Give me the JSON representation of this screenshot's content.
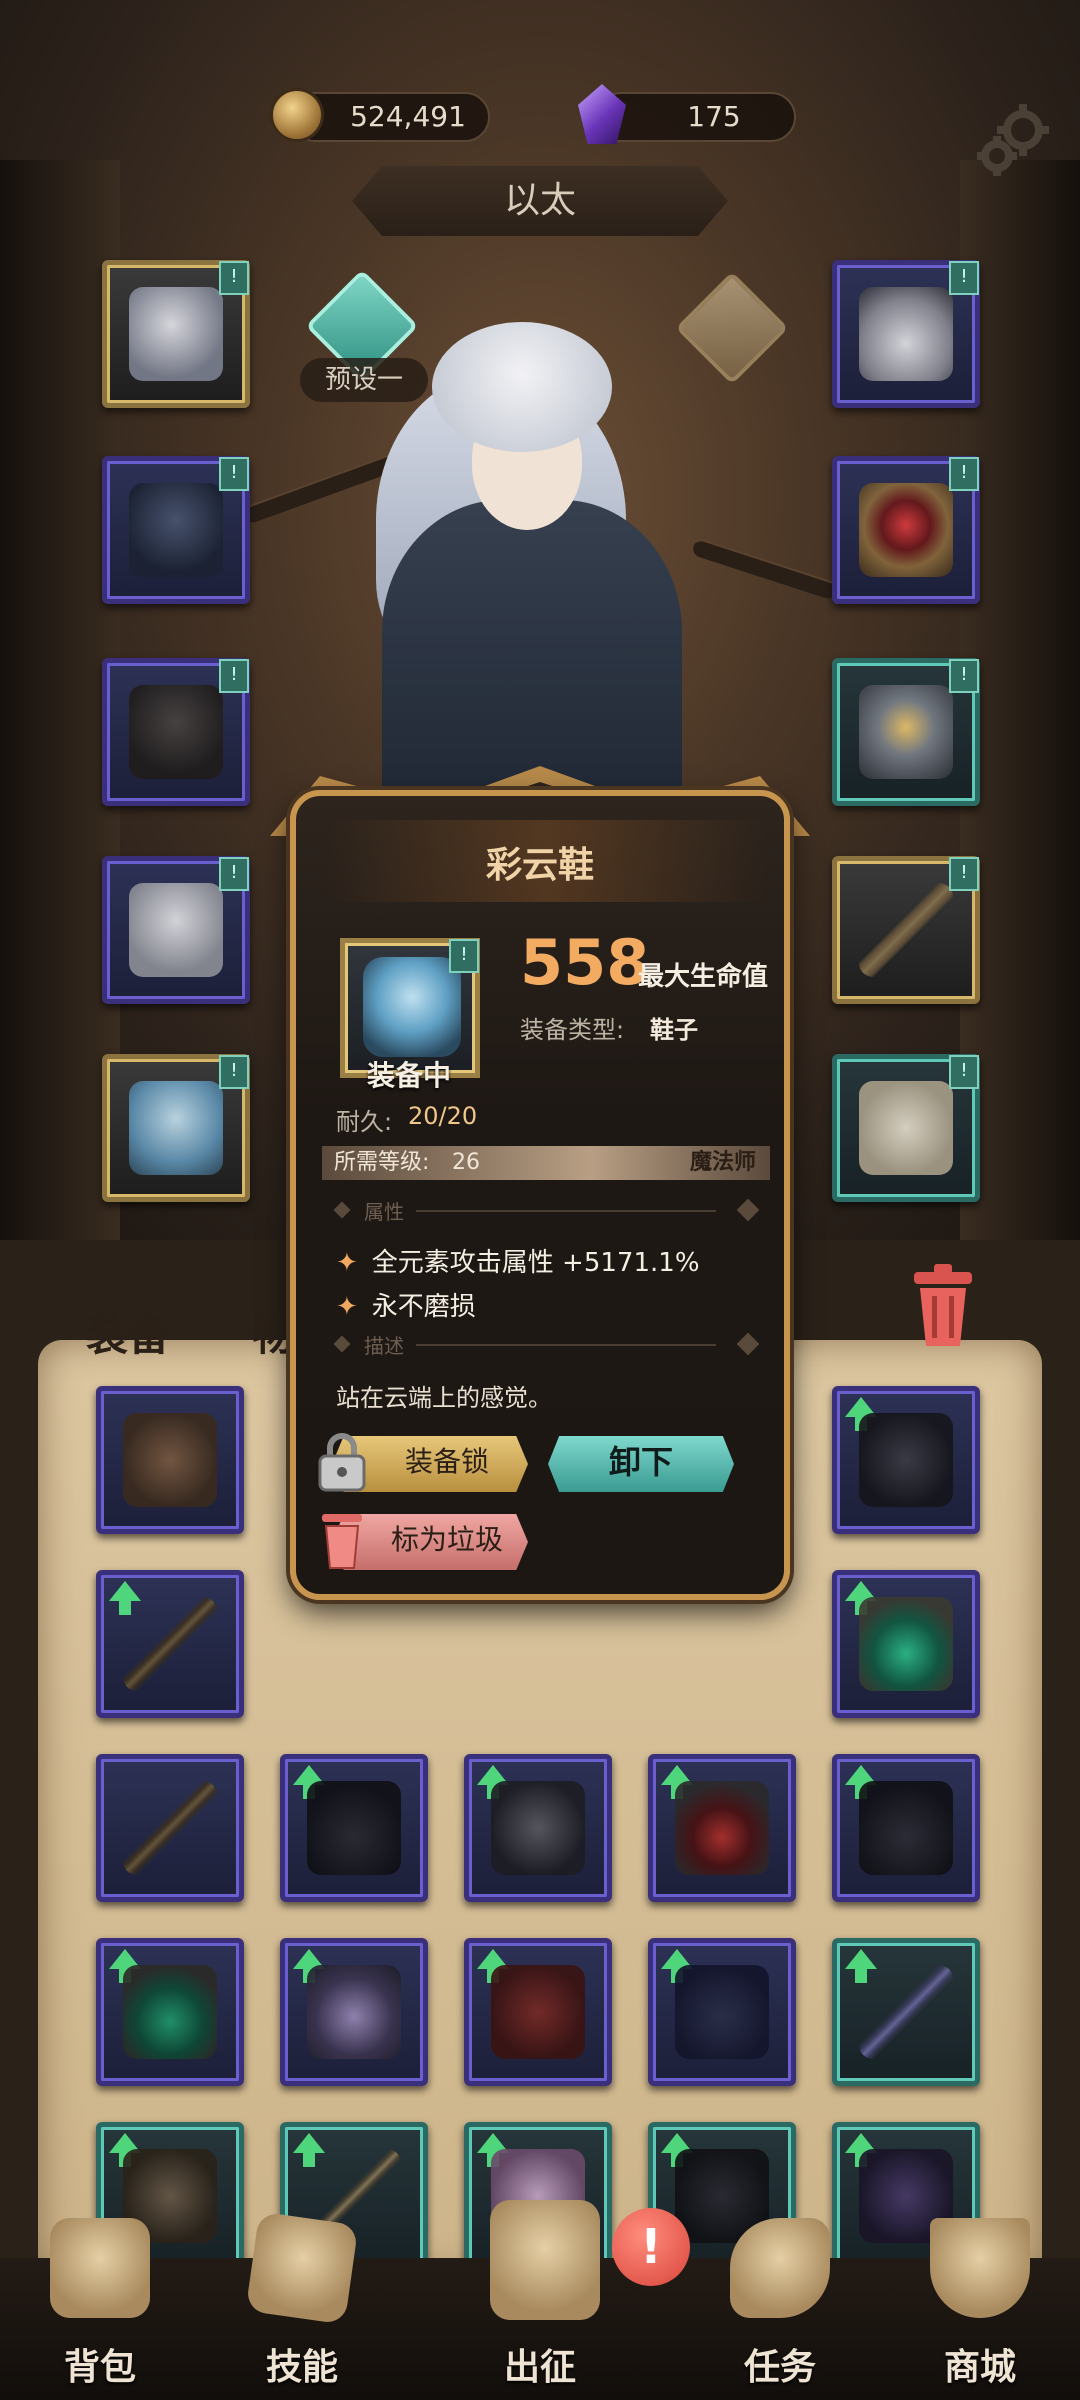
{
  "currency": {
    "coins": "524,491",
    "gems": "175"
  },
  "header": {
    "title": "以太",
    "preset_label": "预设一"
  },
  "equipment_slots": {
    "left": [
      {
        "frame": "gold",
        "flag": "!"
      },
      {
        "frame": "purple",
        "flag": "!"
      },
      {
        "frame": "purple",
        "flag": "!"
      },
      {
        "frame": "purple",
        "flag": "!"
      },
      {
        "frame": "gold",
        "flag": "!"
      }
    ],
    "right": [
      {
        "frame": "purple",
        "flag": "!"
      },
      {
        "frame": "purple",
        "flag": "!"
      },
      {
        "frame": "teal",
        "flag": "!"
      },
      {
        "frame": "gold",
        "flag": "!"
      },
      {
        "frame": "teal",
        "flag": "!"
      }
    ]
  },
  "tabs": {
    "equipment": "装备",
    "items": "物品"
  },
  "popup": {
    "title": "彩云鞋",
    "equipped_label": "装备中",
    "stat_value": "558",
    "stat_label": "最大生命值",
    "type_label": "装备类型:",
    "type_value": "鞋子",
    "durability_label": "耐久:",
    "durability_value": "20/20",
    "required_level_label": "所需等级:",
    "required_level_value": "26",
    "class": "魔法师",
    "attributes_header": "属性",
    "attributes": [
      "全元素攻击属性 +5171.1%",
      "永不磨损"
    ],
    "description_header": "描述",
    "description": "站在云端上的感觉。",
    "lock_button": "装备锁",
    "unequip_button": "卸下",
    "trash_button": "标为垃圾",
    "flag": "!"
  },
  "nav": {
    "items": [
      {
        "label": "背包"
      },
      {
        "label": "技能"
      },
      {
        "label": "出征"
      },
      {
        "label": "任务"
      },
      {
        "label": "商城"
      }
    ],
    "alert": "!"
  },
  "colors": {
    "accent_orange": "#f3ab62",
    "unequip_teal": "#3a9b92",
    "lock_gold": "#b8903e",
    "trash_pink": "#c56e6b",
    "upgrade_green": "#4fd67c"
  }
}
